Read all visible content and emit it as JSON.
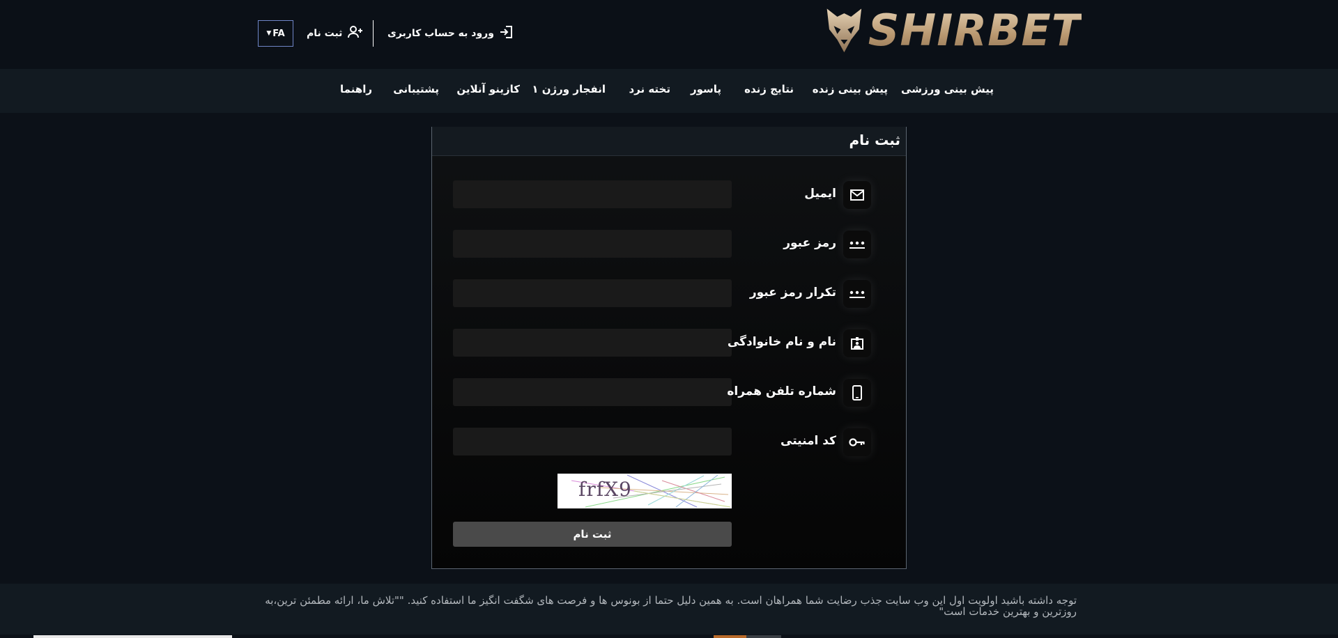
{
  "brand": {
    "name": "SHIRBET",
    "gold": "#c8ad8a"
  },
  "header": {
    "lang": "FA",
    "register_label": "ثبت نام",
    "login_label": "ورود به حساب کاربری"
  },
  "nav": {
    "items": [
      "پیش بینی ورزشی",
      "پیش بینی زنده",
      "نتایج زنده",
      "پاسور",
      "تخته نرد",
      "انفجار ورژن ۱",
      "کازینو آنلاین",
      "پشتیبانی",
      "راهنما"
    ]
  },
  "form": {
    "title": "ثبت نام",
    "fields": [
      {
        "label": "ایمیل",
        "icon": "mail-icon",
        "value": ""
      },
      {
        "label": "رمز عبور",
        "icon": "password-icon",
        "value": ""
      },
      {
        "label": "تکرار رمز عبور",
        "icon": "password-icon",
        "value": ""
      },
      {
        "label": "نام و نام خانوادگی",
        "icon": "id-card-icon",
        "value": ""
      },
      {
        "label": "شماره تلفن همراه",
        "icon": "phone-icon",
        "value": ""
      },
      {
        "label": "کد امنیتی",
        "icon": "key-icon",
        "value": ""
      }
    ],
    "captcha_text": "frfX9",
    "submit_label": "ثبت نام"
  },
  "footer": {
    "text": "توجه داشته باشید اولویت اول این وب سایت جذب رضایت شما همراهان است. به همین دلیل حتما از بونوس ها و فرصت های شگفت انگیز ما استفاده کنید. \"\"تلاش ما، ارائه مطمئن ترین،به روزترین و بهترین خدمات است\""
  }
}
